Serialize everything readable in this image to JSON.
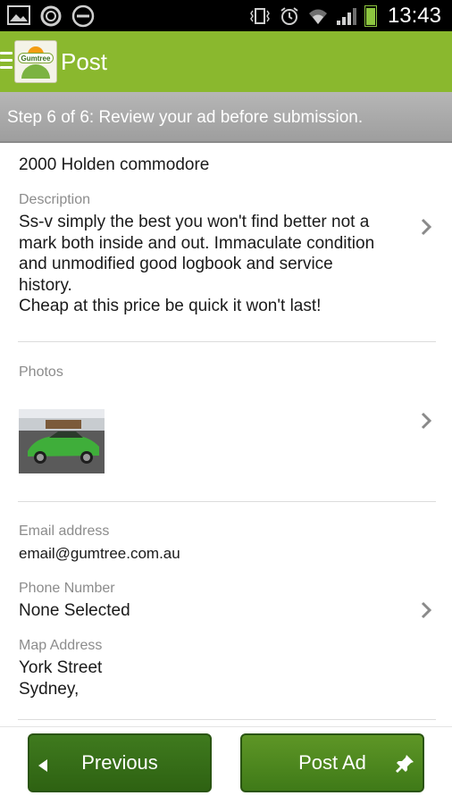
{
  "status_bar": {
    "time": "13:43",
    "icons_left": [
      "image-icon",
      "sync-icon",
      "do-not-disturb-icon"
    ],
    "icons_right": [
      "vibrate-icon",
      "alarm-icon",
      "wifi-icon",
      "signal-icon",
      "battery-icon"
    ],
    "battery_level": 0.95
  },
  "action_bar": {
    "title": "Post",
    "logo_text": "Gumtree",
    "menu_icon": "hamburger-icon"
  },
  "step_banner": {
    "text": "Step 6 of 6: Review your ad before submission."
  },
  "ad": {
    "title": "2000 Holden commodore",
    "description_label": "Description",
    "description_lines": [
      "Ss-v simply the best you won't find better not a",
      "mark both inside and out. Immaculate condition",
      "and unmodified good logbook and service",
      "history.",
      "Cheap at this price be quick it won't last!"
    ],
    "photos_label": "Photos",
    "email_label": "Email address",
    "email_value": "email@gumtree.com.au",
    "phone_label": "Phone Number",
    "phone_value": "None Selected",
    "map_label": "Map Address",
    "map_lines": [
      "York Street",
      "Sydney,"
    ]
  },
  "buttons": {
    "previous_label": "Previous",
    "post_label": "Post Ad"
  },
  "colors": {
    "action_bar": "#8ab82e",
    "button_green": "#3f7a1e",
    "label_gray": "#8c8c8c"
  }
}
